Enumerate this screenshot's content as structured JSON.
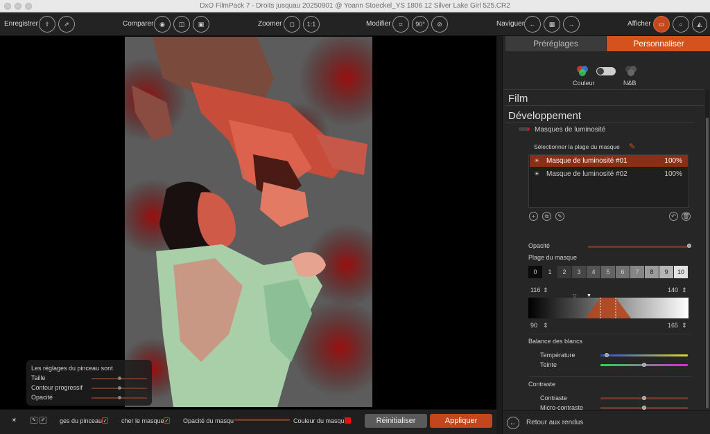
{
  "window": {
    "title": "DxO FilmPack 7 - Droits jusquau 20250901 @ Yoann Stoeckel_YS 1806 12 Silver Lake Girl 525.CR2"
  },
  "toolbar": {
    "enregistrer": "Enregistrer",
    "comparer": "Comparer",
    "zoomer": "Zoomer",
    "zoom_1_1": "1:1",
    "modifier": "Modifier",
    "rotate_90": "90°",
    "naviguer": "Naviguer",
    "afficher": "Afficher"
  },
  "brush_panel": {
    "title": "Les réglages du pinceau sont",
    "taille": "Taille",
    "contour": "Contour progressif",
    "opacite": "Opacité",
    "taille_level": 0.5,
    "contour_level": 0.5,
    "opacite_level": 0.5
  },
  "bottom": {
    "reglages_pinceau": "ges du pinceau",
    "afficher_masque": "cher le masque",
    "opacite_masque": "Opacité du masqu",
    "couleur_masque": "Couleur du masqu",
    "reinitialiser": "Réinitialiser",
    "appliquer": "Appliquer",
    "check": "✓",
    "mask_color": "#e3120b"
  },
  "panel": {
    "tab_presets": "Préréglages",
    "tab_custom": "Personnaliser",
    "mode_color": "Couleur",
    "mode_bw": "N&B",
    "section_film": "Film",
    "section_dev": "Développement",
    "masques_title": "Masques de luminosité",
    "select_range": "Sélectionner la plage du masque",
    "masks": [
      {
        "name": "Masque de luminosité #01",
        "value": "100%"
      },
      {
        "name": "Masque de luminosité #02",
        "value": "100%"
      }
    ],
    "opacite": "Opacité",
    "plage": "Plage du masque",
    "zones": [
      "0",
      "1",
      "2",
      "3",
      "4",
      "5",
      "6",
      "7",
      "8",
      "9",
      "10"
    ],
    "range_top_low": "116",
    "range_top_high": "140",
    "range_bottom_low": "90",
    "range_bottom_high": "165",
    "stepper": "⇕",
    "balance": "Balance des blancs",
    "temperature": "Température",
    "teinte": "Teinte",
    "contraste_section": "Contraste",
    "contraste": "Contraste",
    "micro_contraste": "Micro-contraste",
    "retour": "Retour aux rendus",
    "accent": "#d6521c"
  }
}
